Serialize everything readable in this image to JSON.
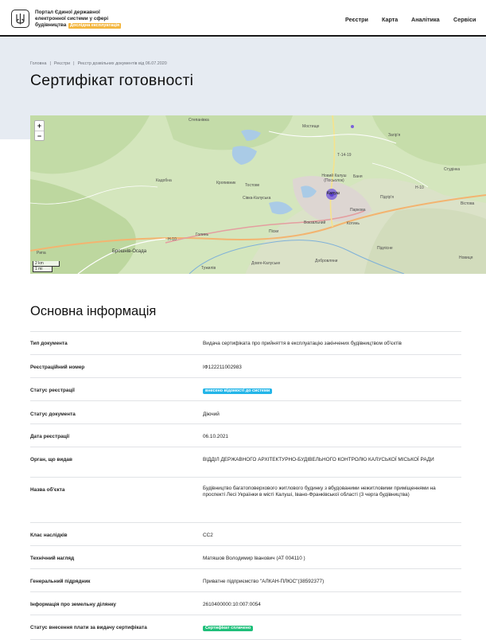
{
  "header": {
    "brand_line1": "Портал Єдиної державної",
    "brand_line2": "електронної системи у сфері",
    "brand_line3": "будівництва",
    "badge": "Дослідна експлуатація",
    "nav": [
      "Реєстри",
      "Карта",
      "Аналітика",
      "Сервіси"
    ]
  },
  "breadcrumb": [
    "Головна",
    "Реєстри",
    "Реєстр дозвільних документів від 06.07.2020"
  ],
  "page_title": "Сертифікат готовності",
  "map": {
    "zoom_in": "+",
    "zoom_out": "−",
    "scale_km": "2 km",
    "scale_mi": "1 mi",
    "labels": {
      "stepanivka": "Степанівка",
      "mostyshche": "Мостище",
      "zahiria": "Загір'я",
      "road_t1419": "Т-14-19",
      "kadobna": "Кадобна",
      "kropyvnyk": "Кропивник",
      "tostove": "Тостове",
      "sivka": "Сівка-Калуська",
      "novyi_kalush": "Новий Калуш (Посьолок)",
      "banya": "Баня",
      "kalush": "Калуш",
      "pidhirya": "Підгір'я",
      "studinka": "Студінка",
      "road_n10_east": "Н-10",
      "vistova": "Вістова",
      "parkova": "Паркова",
      "vokzalnyi": "Вокзальний",
      "kotsyn": "Котинь",
      "pisky": "Піски",
      "road_n10_west": "Н-10",
      "holyn": "Голинь",
      "rypa": "Рипа",
      "broshniv": "Брошнів-Осада",
      "dovhe": "Довге-Калуське",
      "tuzhyliv": "Тужилів",
      "dobrovlyany": "Добровляни",
      "pidlisne": "Підлісне",
      "novytsia": "Новиця"
    }
  },
  "section_title": "Основна інформація",
  "rows": [
    {
      "k": "Тип документа",
      "v": "Видача сертифіката про прийняття в експлуатацію закінчених будівництвом об'єктів"
    },
    {
      "k": "Реєстраційний номер",
      "v": "ІФ122211002983"
    },
    {
      "k": "Статус реєстрації",
      "v": "внесено відомості до системи"
    },
    {
      "k": "Статус документа",
      "v": "Діючий"
    },
    {
      "k": "Дата реєстрації",
      "v": "06.10.2021"
    },
    {
      "k": "Орган, що видав",
      "v": "ВІДДІЛ ДЕРЖАВНОГО АРХІТЕКТУРНО-БУДІВЕЛЬНОГО КОНТРОЛЮ КАЛУСЬКОЇ МІСЬКОЇ РАДИ"
    },
    {
      "k": "Назва об'єкта",
      "v": "Будівництво багатоповерхового житлового будинку з вбудованими нежитловими приміщеннями на проспекті Лесі Українки в місті Калуші, Івано-Франківської області (3 черга будівництва)"
    },
    {
      "k": "Клас наслідків",
      "v": "СС2"
    },
    {
      "k": "Технічний нагляд",
      "v": "Матяшов Володимир Іванович (АТ 004110 )"
    },
    {
      "k": "Генеральний підрядник",
      "v": "Приватне підприємство \"АЛКАН-ПЛЮС\"(38592377)"
    },
    {
      "k": "Інформація про земельну ділянку",
      "v": "2610400000:10:007:0054"
    },
    {
      "k": "Статус внесення плати за видачу сертифіката",
      "v": "Сертифікат сплачено"
    }
  ],
  "colors": {
    "accent_badge": "#f3b63f",
    "status_blue": "#23b5e8",
    "status_green": "#1fbf7a",
    "hero_bg": "#e6ebf2"
  }
}
